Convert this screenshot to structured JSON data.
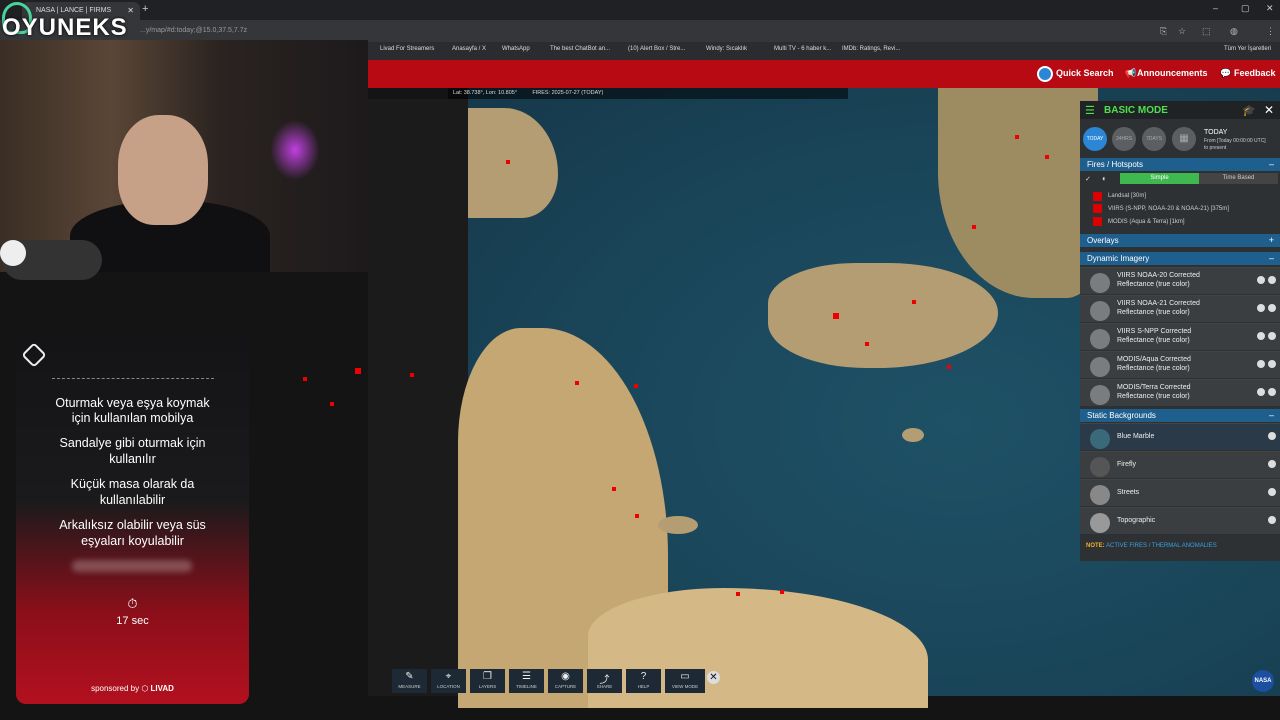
{
  "browser": {
    "tab_title": "NASA | LANCE | FIRMS",
    "url": "...y/map/#d:today;@15.0,37.5,7.7z",
    "newtab": "+",
    "min": "–",
    "max": "▢",
    "close": "✕"
  },
  "bookmarks": [
    {
      "label": "Livad For Streamers"
    },
    {
      "label": "Anasayfa / X"
    },
    {
      "label": "WhatsApp"
    },
    {
      "label": "The best ChatBot an..."
    },
    {
      "label": "(10) Alert Box / Stre..."
    },
    {
      "label": "Windy: Sıcaklık"
    },
    {
      "label": "Multi TV - 6 haber k..."
    },
    {
      "label": "IMDb: Ratings, Revi..."
    },
    {
      "label": "Tüm Yer İşaretleri"
    }
  ],
  "overlay": {
    "logo": "OYUNEKS"
  },
  "firms": {
    "quick_search": "Quick Search",
    "announcements": "Announcements",
    "feedback": "Feedback",
    "coords": "Lat: 38.738°, Lon: 10.805°",
    "fires_date": "FIRES: 2025-07-27 (TODAY)"
  },
  "panel": {
    "title": "BASIC MODE",
    "days": [
      "TODAY",
      "24HRS",
      "7DAYS"
    ],
    "today_label": "TODAY",
    "today_sub": "From [Today 00:00:00 UTC] to present",
    "fires_section": "Fires / Hotspots",
    "simple": "Simple",
    "time_based": "Time Based",
    "fire_layers": [
      "Landsat [30m]",
      "VIIRS (S-NPP, NOAA-20 & NOAA-21) [375m]",
      "MODIS (Aqua & Terra) [1km]"
    ],
    "overlays": "Overlays",
    "dynamic": "Dynamic Imagery",
    "dynamic_layers": [
      {
        "line1": "VIIRS NOAA-20 Corrected",
        "line2": "Reflectance (true color)"
      },
      {
        "line1": "VIIRS NOAA-21 Corrected",
        "line2": "Reflectance (true color)"
      },
      {
        "line1": "VIIRS S-NPP Corrected",
        "line2": "Reflectance (true color)"
      },
      {
        "line1": "MODIS/Aqua Corrected",
        "line2": "Reflectance (true color)"
      },
      {
        "line1": "MODIS/Terra Corrected",
        "line2": "Reflectance (true color)"
      }
    ],
    "static": "Static Backgrounds",
    "static_layers": [
      "Blue Marble",
      "Firefly",
      "Streets",
      "Topographic"
    ],
    "note_label": "NOTE:",
    "note_text": "ACTIVE FIRES / THERMAL ANOMALIES"
  },
  "toolbar": [
    "MEASURE",
    "LOCATION",
    "LAYERS",
    "TIMELINE",
    "CAPTURE",
    "SHARE",
    "HELP",
    "VIEW MODE"
  ],
  "toolbar_icons": [
    "✎",
    "⌖",
    "❐",
    "☰",
    "◉",
    "⤴",
    "?",
    "▭"
  ],
  "nasa": "NASA",
  "card": {
    "lines": [
      "Oturmak veya eşya koymak",
      "için kullanılan mobilya",
      "Sandalye gibi oturmak için",
      "kullanılır",
      "Küçük masa olarak da",
      "kullanılabilir",
      "Arkalıksız olabilir veya süs",
      "eşyaları koyulabilir"
    ],
    "timer": "17 sec",
    "sponsor": "sponsored by",
    "sponsor_brand": "LIVAD"
  }
}
